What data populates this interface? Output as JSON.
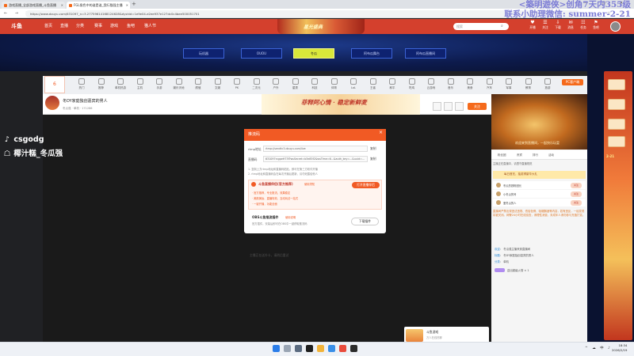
{
  "browser": {
    "tabs": [
      {
        "label": "游戏直播_全部游戏直播_斗鱼直播"
      },
      {
        "label": "FGL角色中的谁是谁_我行猫强主播"
      },
      {
        "label": ""
      }
    ],
    "new_tab_symbol": "+",
    "window_controls": "— ▢ ✕",
    "nav_symbols": "← → ↻ ⌂",
    "url": "https://www.douyu.com/631097_n=3.27759614168124628&dyshid=1e9e04-e2ee937e127dc0c4bee500051701",
    "icons": "☆ ⋮"
  },
  "watermark": {
    "line1": "<築明遊俠>创角7天内355级",
    "line2": "联系小助理微信: summer-2-21"
  },
  "header": {
    "logo": "斗鱼",
    "menus": [
      "首页",
      "直播",
      "分类",
      "赛事",
      "游戏",
      "鱼吧",
      "猫人节"
    ],
    "brand_text": "星光盛典",
    "search_placeholder": "搜索",
    "search_symbol": "⌕",
    "icons": [
      {
        "symbol": "♥",
        "label": "开播"
      },
      {
        "symbol": "☰",
        "label": "关注"
      },
      {
        "symbol": "⇩",
        "label": "下载"
      },
      {
        "symbol": "✉",
        "label": "消息"
      },
      {
        "symbol": "☷",
        "label": "任务"
      },
      {
        "symbol": "⚑",
        "label": "鱼吧"
      },
      {
        "symbol": "★",
        "label": "贵族"
      }
    ]
  },
  "hero": {
    "buttons": [
      "玩机器",
      "OUOU",
      "冬瓜",
      "阿布瓜舞台",
      "阿布瓜直播间"
    ],
    "active_index": 2
  },
  "categories": {
    "left_count": "6",
    "items": [
      "热门",
      "推荐",
      "单机热游",
      "主机",
      "手游",
      "娱乐天地",
      "颜值",
      "文娱",
      "PK",
      "二次元",
      "户外",
      "星秀",
      "科技",
      "体育",
      "LoL",
      "王者",
      "和平",
      "吃鸡",
      "云游戏",
      "音乐",
      "美食",
      "汽车",
      "军事",
      "教育",
      "旅游",
      "体育赛事"
    ],
    "pc_button": "PC客户端"
  },
  "room": {
    "title": "冬DY家庭独创嘉宾的男人",
    "subtitle": "冬瓜强 · 单机 · 171286",
    "banner": "菲释阿心情 · 稳定新鲜麦",
    "follow_label": "关注",
    "follow_count": "+3"
  },
  "video": {
    "status_text": "主播正在送外卡，请稍后重试",
    "promo_title": "斗鱼游戏",
    "promo_sub": "万人在线热聊"
  },
  "dialog": {
    "title": "推流码",
    "close_symbol": "×",
    "rtmp_label": "rtmp地址",
    "rtmp_value": "rtmp://sendtc3.douyu.com/live",
    "key_label": "直播码",
    "key_value": "631097rcgpeH73f?wsSecret=b3e85f2&wsTime=6...&auth_key=...&uuid=...",
    "copy_label": "复制",
    "note1": "1. 复制上方rtmp地址和直播码粘贴，即可在第三方软件开播",
    "note2": "2. rtmp地址和直播码会在每次开播后更新，请勿泄露给他人",
    "warn_title": "斗鱼直播伴侣(官方推荐)",
    "warn_tag": "使用须知",
    "warn_button": "打开直播伴侣",
    "warn_lines": [
      "· 官方推荐，专业推流，效果稳定",
      "· 美颜美妆、直播特效、互动玩法一站式",
      "· 一键开播，功能全面"
    ],
    "obs_title": "OBS斗鱼推流插件",
    "obs_tag": "使用说明",
    "obs_desc": "官方插件，安装后即可在OBS中一键获取推流码",
    "download_label": "下载插件"
  },
  "right_panel": {
    "video_caption": "欢迎来到直播间，一起快乐玩耍",
    "tabs": [
      "粉丝团",
      "贵宾",
      "排行",
      "活动"
    ],
    "notice": "主播正在直播中，请遵守直播规范",
    "banner": "每日首充，抽奖得豪华大礼",
    "ranks": [
      {
        "text": "冬瓜的铁粉团长",
        "btn": "关注"
      },
      {
        "text": "小冬瓜的号",
        "btn": "关注"
      },
      {
        "text": "爱冬瓜的人",
        "btn": "关注"
      }
    ],
    "system_message": "直播间严禁出现违法违规、低俗色情、吸烟酗酒等内容，若有违反，一经发现将被关闭。网警24小时在线巡查，请理性消费，未成年人请勿参与充值打赏。",
    "chat": [
      {
        "user": "欢迎",
        "msg": "冬瓜强主播来到直播间"
      },
      {
        "user": "标题",
        "msg": "冬DY家庭独创嘉宾的男人"
      },
      {
        "user": "分类",
        "msg": "单机"
      }
    ],
    "gift_text": "送出超级火箭 × 1"
  },
  "side": {
    "date": "2-21"
  },
  "tiktok": {
    "handle": "csgodg",
    "name": "椰汁糕_冬瓜强",
    "handle_icon": "♪",
    "name_icon": "☖"
  },
  "taskbar": {
    "time": "18:34",
    "date": "2026/2/19",
    "tray": "^ ☁ 中 ♪"
  }
}
